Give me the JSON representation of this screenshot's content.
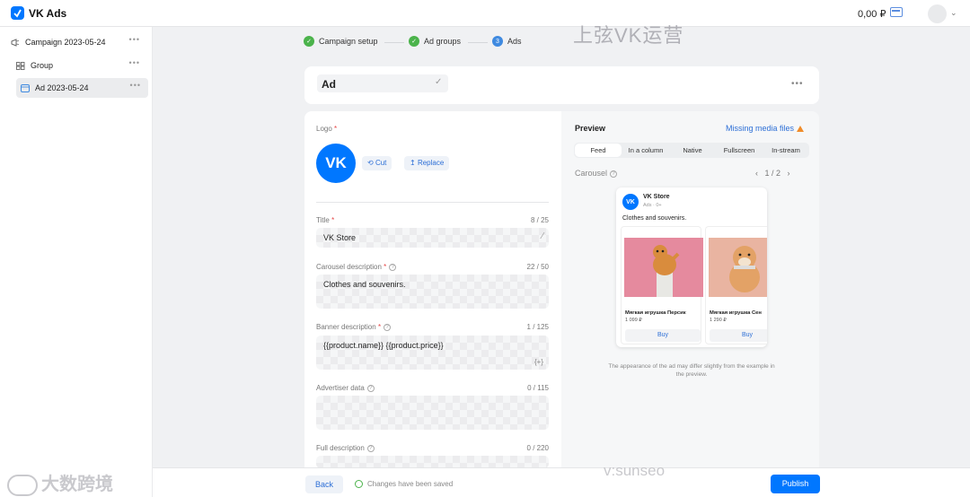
{
  "app": {
    "title": "VK Ads",
    "balance": "0,00 ₽"
  },
  "sidebar": {
    "items": [
      {
        "label": "Campaign 2023-05-24"
      },
      {
        "label": "Group"
      },
      {
        "label": "Ad 2023-05-24"
      }
    ]
  },
  "stepper": {
    "steps": [
      {
        "label": "Campaign setup",
        "state": "done"
      },
      {
        "label": "Ad groups",
        "state": "done"
      },
      {
        "label": "Ads",
        "number": "3",
        "state": "current"
      }
    ]
  },
  "ad": {
    "name": "Ad"
  },
  "form": {
    "logo": {
      "label": "Logo",
      "cut_label": "Cut",
      "replace_label": "Replace",
      "logo_text": "VK"
    },
    "title": {
      "label": "Title",
      "value": "VK Store",
      "counter": "8 / 25"
    },
    "carousel_description": {
      "label": "Carousel description",
      "value": "Clothes and souvenirs.",
      "counter": "22 / 50"
    },
    "banner_description": {
      "label": "Banner description",
      "value": "{{product.name}} {{product.price}}",
      "counter": "1 / 125",
      "insert_glyph": "{+}"
    },
    "advertiser_data": {
      "label": "Advertiser data",
      "counter": "0 / 115"
    },
    "full_description": {
      "label": "Full description",
      "counter": "0 / 220"
    }
  },
  "preview": {
    "title": "Preview",
    "missing_media": "Missing media files",
    "tabs": [
      "Feed",
      "In a column",
      "Native",
      "Fullscreen",
      "In-stream"
    ],
    "active_tab": "Feed",
    "carousel_label": "Carousel",
    "pager": "1 / 2",
    "post": {
      "brand": "VK Store",
      "meta": "Ads · 0+",
      "logo_text": "VK",
      "description": "Clothes and souvenirs.",
      "cards": [
        {
          "title": "Мягкая игрушка Персик",
          "price": "1 099 ₽",
          "button": "Buy"
        },
        {
          "title": "Мягкая игрушка Сен",
          "price": "1 290 ₽",
          "button": "Buy"
        }
      ]
    },
    "disclaimer": "The appearance of the ad may differ slightly from the example in the preview."
  },
  "footer": {
    "back_label": "Back",
    "saved_label": "Changes have been saved",
    "publish_label": "Publish"
  },
  "watermarks": {
    "top": "上弦VK运营",
    "bottom": "v:sunseo",
    "corner": "大数跨境"
  },
  "colors": {
    "accent": "#0077ff",
    "success": "#4bb34b",
    "warning": "#f08c2a"
  }
}
